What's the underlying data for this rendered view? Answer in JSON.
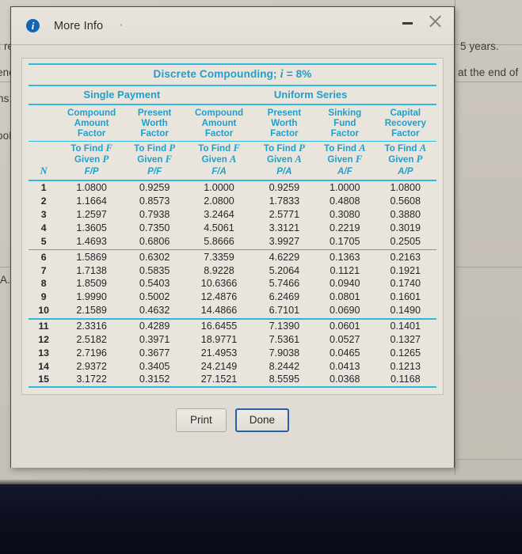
{
  "background": {
    "left_fragments": [
      "l re",
      "ene",
      "ns:",
      "ooL",
      "A."
    ],
    "right_fragments": [
      "5  years.",
      "at the end of"
    ]
  },
  "dialog": {
    "title": "More Info",
    "info_icon": "info-icon",
    "title_speck": "'",
    "window_controls": {
      "minimize": "minimize-icon",
      "close": "close-icon"
    },
    "buttons": {
      "print": "Print",
      "done": "Done"
    }
  },
  "table": {
    "title_main": "Discrete Compounding; ",
    "title_i": "i",
    "title_rate": " = 8%",
    "groups": [
      {
        "label": "Single Payment"
      },
      {
        "label": "Uniform Series"
      }
    ],
    "n_header": "N",
    "columns": [
      {
        "name_lines": [
          "Compound",
          "Amount",
          "Factor"
        ],
        "find_line1_pre": "To Find ",
        "find_line1_sym": "F",
        "find_line2_pre": "Given ",
        "find_line2_sym": "P",
        "ratio": "F/P"
      },
      {
        "name_lines": [
          "Present",
          "Worth",
          "Factor"
        ],
        "find_line1_pre": "To Find ",
        "find_line1_sym": "P",
        "find_line2_pre": "Given ",
        "find_line2_sym": "F",
        "ratio": "P/F"
      },
      {
        "name_lines": [
          "Compound",
          "Amount",
          "Factor"
        ],
        "find_line1_pre": "To Find ",
        "find_line1_sym": "F",
        "find_line2_pre": "Given ",
        "find_line2_sym": "A",
        "ratio": "F/A"
      },
      {
        "name_lines": [
          "Present",
          "Worth",
          "Factor"
        ],
        "find_line1_pre": "To Find ",
        "find_line1_sym": "P",
        "find_line2_pre": "Given ",
        "find_line2_sym": "A",
        "ratio": "P/A"
      },
      {
        "name_lines": [
          "Sinking",
          "Fund",
          "Factor"
        ],
        "find_line1_pre": "To Find ",
        "find_line1_sym": "A",
        "find_line2_pre": "Given ",
        "find_line2_sym": "F",
        "ratio": "A/F"
      },
      {
        "name_lines": [
          "Capital",
          "Recovery",
          "Factor"
        ],
        "find_line1_pre": "To Find ",
        "find_line1_sym": "A",
        "find_line2_pre": "Given ",
        "find_line2_sym": "P",
        "ratio": "A/P"
      }
    ],
    "rows": [
      {
        "n": "1",
        "v": [
          "1.0800",
          "0.9259",
          "1.0000",
          "0.9259",
          "1.0000",
          "1.0800"
        ]
      },
      {
        "n": "2",
        "v": [
          "1.1664",
          "0.8573",
          "2.0800",
          "1.7833",
          "0.4808",
          "0.5608"
        ]
      },
      {
        "n": "3",
        "v": [
          "1.2597",
          "0.7938",
          "3.2464",
          "2.5771",
          "0.3080",
          "0.3880"
        ]
      },
      {
        "n": "4",
        "v": [
          "1.3605",
          "0.7350",
          "4.5061",
          "3.3121",
          "0.2219",
          "0.3019"
        ]
      },
      {
        "n": "5",
        "v": [
          "1.4693",
          "0.6806",
          "5.8666",
          "3.9927",
          "0.1705",
          "0.2505"
        ]
      },
      {
        "n": "6",
        "v": [
          "1.5869",
          "0.6302",
          "7.3359",
          "4.6229",
          "0.1363",
          "0.2163"
        ]
      },
      {
        "n": "7",
        "v": [
          "1.7138",
          "0.5835",
          "8.9228",
          "5.2064",
          "0.1121",
          "0.1921"
        ]
      },
      {
        "n": "8",
        "v": [
          "1.8509",
          "0.5403",
          "10.6366",
          "5.7466",
          "0.0940",
          "0.1740"
        ]
      },
      {
        "n": "9",
        "v": [
          "1.9990",
          "0.5002",
          "12.4876",
          "6.2469",
          "0.0801",
          "0.1601"
        ]
      },
      {
        "n": "10",
        "v": [
          "2.1589",
          "0.4632",
          "14.4866",
          "6.7101",
          "0.0690",
          "0.1490"
        ]
      },
      {
        "n": "11",
        "v": [
          "2.3316",
          "0.4289",
          "16.6455",
          "7.1390",
          "0.0601",
          "0.1401"
        ]
      },
      {
        "n": "12",
        "v": [
          "2.5182",
          "0.3971",
          "18.9771",
          "7.5361",
          "0.0527",
          "0.1327"
        ]
      },
      {
        "n": "13",
        "v": [
          "2.7196",
          "0.3677",
          "21.4953",
          "7.9038",
          "0.0465",
          "0.1265"
        ]
      },
      {
        "n": "14",
        "v": [
          "2.9372",
          "0.3405",
          "24.2149",
          "8.2442",
          "0.0413",
          "0.1213"
        ]
      },
      {
        "n": "15",
        "v": [
          "3.1722",
          "0.3152",
          "27.1521",
          "8.5595",
          "0.0368",
          "0.1168"
        ]
      }
    ],
    "group_breaks": [
      5,
      10
    ]
  },
  "colors": {
    "accent_cyan": "#1f9fcd",
    "rule_cyan": "#31b6dd",
    "info_blue": "#1464b4",
    "focus_blue": "#2a5fa5"
  }
}
